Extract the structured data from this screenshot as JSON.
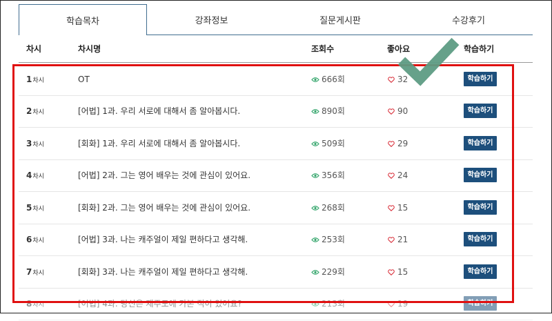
{
  "tabs": [
    "학습목차",
    "강좌정보",
    "질문게시판",
    "수강후기"
  ],
  "active_tab": 0,
  "columns": {
    "num": "차시",
    "title": "차시명",
    "views": "조회수",
    "likes": "좋아요",
    "action": "학습하기"
  },
  "session_suffix": "차시",
  "views_suffix": "회",
  "rows": [
    {
      "num": "1",
      "title": "OT",
      "views": "666",
      "likes": "32",
      "button": "학습하기"
    },
    {
      "num": "2",
      "title": "[어법] 1과. 우리 서로에 대해서 좀 알아봅시다.",
      "views": "890",
      "likes": "90",
      "button": "학습하기"
    },
    {
      "num": "3",
      "title": "[회화] 1과. 우리 서로에 대해서 좀 알아봅시다.",
      "views": "509",
      "likes": "29",
      "button": "학습하기"
    },
    {
      "num": "4",
      "title": "[어법] 2과. 그는 영어 배우는 것에 관심이 있어요.",
      "views": "356",
      "likes": "24",
      "button": "학습하기"
    },
    {
      "num": "5",
      "title": "[회화] 2과. 그는 영어 배우는 것에 관심이 있어요.",
      "views": "268",
      "likes": "15",
      "button": "학습하기"
    },
    {
      "num": "6",
      "title": "[어법] 3과. 나는 캐주얼이 제일 편하다고 생각해.",
      "views": "253",
      "likes": "21",
      "button": "학습하기"
    },
    {
      "num": "7",
      "title": "[회화] 3과. 나는 캐주얼이 제일 편하다고 생각해.",
      "views": "229",
      "likes": "15",
      "button": "학습하기"
    },
    {
      "num": "8",
      "title": "[어법] 4과. 당신은 제주도에 가본 적이 있어요?",
      "views": "213",
      "likes": "19",
      "button": "학습하기"
    }
  ],
  "colors": {
    "accent": "#1d4f7c",
    "tab_border": "#3f6c8f",
    "highlight_box": "#e01010",
    "checkmark": "#5e9c84",
    "eye_icon": "#3aa870",
    "heart_icon": "#d9323d"
  }
}
